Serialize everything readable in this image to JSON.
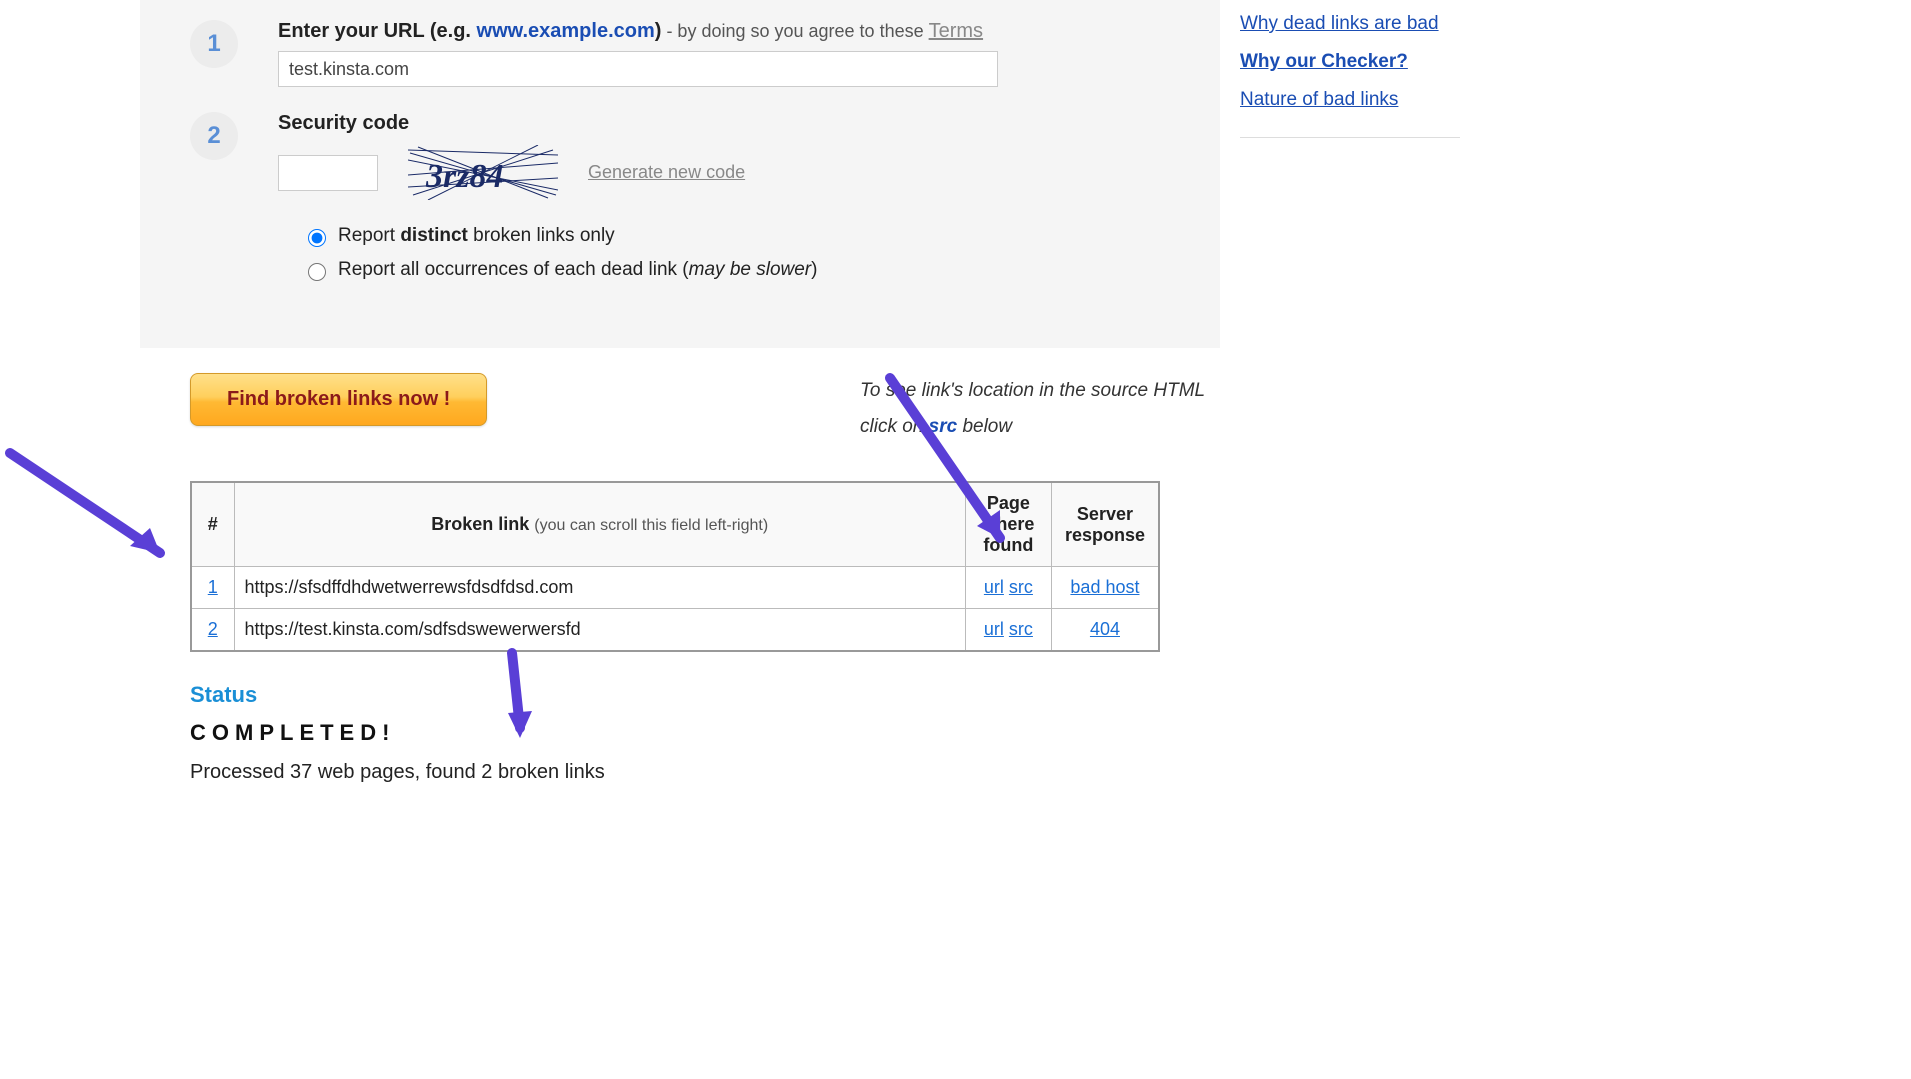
{
  "form": {
    "step1_badge": "1",
    "step1_label_pre": "Enter your URL (e.g. ",
    "step1_label_eg": "www.example.com",
    "step1_label_post": ")",
    "step1_sub": " - by doing so you agree to these ",
    "step1_terms": "Terms",
    "url_value": "test.kinsta.com",
    "step2_badge": "2",
    "step2_label": "Security code",
    "captcha_text": "3rz84",
    "gen_code": "Generate new code",
    "radio_distinct_pre": "Report ",
    "radio_distinct_bold": "distinct",
    "radio_distinct_post": " broken links only",
    "radio_all_pre": "Report all occurrences of each dead link (",
    "radio_all_em": "may be slower",
    "radio_all_post": ")"
  },
  "results": {
    "button": "Find broken links now !",
    "hint_line1": "To see link's location in the source HTML",
    "hint_line2_pre": "click on ",
    "hint_line2_src": "src",
    "hint_line2_post": " below",
    "headers": {
      "hash": "#",
      "link_main": "Broken link",
      "link_sub": "(you can scroll this field left-right)",
      "where_l1": "Page",
      "where_l2": "where",
      "where_l3": "found",
      "resp_l1": "Server",
      "resp_l2": "response"
    },
    "rows": [
      {
        "n": "1",
        "link": "https://sfsdffdhdwetwerrewsfdsdfdsd.com",
        "url": "url",
        "src": "src",
        "resp": "bad host"
      },
      {
        "n": "2",
        "link": "https://test.kinsta.com/sdfsdswewerwersfd",
        "url": "url",
        "src": "src",
        "resp": "404"
      }
    ]
  },
  "status": {
    "title": "Status",
    "completed": "COMPLETED!",
    "summary": "Processed 37 web pages, found 2 broken links"
  },
  "sidebar": {
    "links": [
      "Why dead links are bad",
      "Why our Checker?",
      "Nature of bad links"
    ]
  }
}
